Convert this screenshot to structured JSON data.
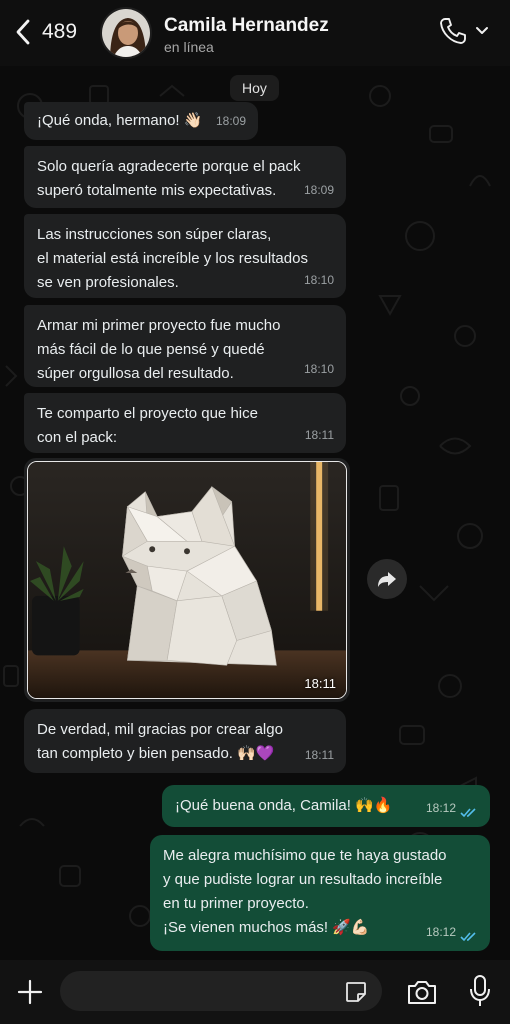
{
  "header": {
    "back_count": "489",
    "contact_name": "Camila Hernandez",
    "status": "en línea"
  },
  "icons": {
    "back": "chevron-left-icon",
    "call": "phone-icon",
    "call_menu": "chevron-down-icon",
    "forward": "forward-icon",
    "plus": "plus-icon",
    "sticker": "sticker-icon",
    "camera": "camera-icon",
    "mic": "microphone-icon",
    "read": "double-check-icon"
  },
  "colors": {
    "incoming_bubble": "#1f2021",
    "outgoing_bubble": "#134d37",
    "read_ticks": "#53bdeb",
    "background": "#0b0b0b"
  },
  "chat": {
    "date_label": "Hoy",
    "messages": [
      {
        "direction": "in",
        "text": "¡Qué onda, hermano! 👋🏻",
        "time": "18:09"
      },
      {
        "direction": "in",
        "text": "Solo quería agradecerte porque el pack\nsuperó totalmente mis expectativas.",
        "time": "18:09"
      },
      {
        "direction": "in",
        "text": "Las instrucciones son súper claras,\nel material está increíble y los resultados\nse ven profesionales.",
        "time": "18:10"
      },
      {
        "direction": "in",
        "text": "Armar mi primer proyecto fue mucho\nmás fácil de lo que pensé y quedé\nsúper orgullosa del resultado.",
        "time": "18:10"
      },
      {
        "direction": "in",
        "text": "Te comparto el proyecto que hice\ncon el pack:",
        "time": "18:11"
      },
      {
        "direction": "in",
        "type": "image",
        "time": "18:11"
      },
      {
        "direction": "in",
        "text": "De verdad, mil gracias por crear algo\ntan completo y bien pensado. 🙌🏻💜",
        "time": "18:11"
      },
      {
        "direction": "out",
        "text": "¡Qué buena onda, Camila! 🙌🔥",
        "time": "18:12",
        "status": "read"
      },
      {
        "direction": "out",
        "text": "Me alegra muchísimo que te haya gustado\ny que pudiste lograr un resultado increíble\nen tu primer proyecto.\n¡Se vienen muchos más! 🚀💪🏻",
        "time": "18:12",
        "status": "read"
      }
    ]
  },
  "composer": {
    "placeholder": ""
  }
}
